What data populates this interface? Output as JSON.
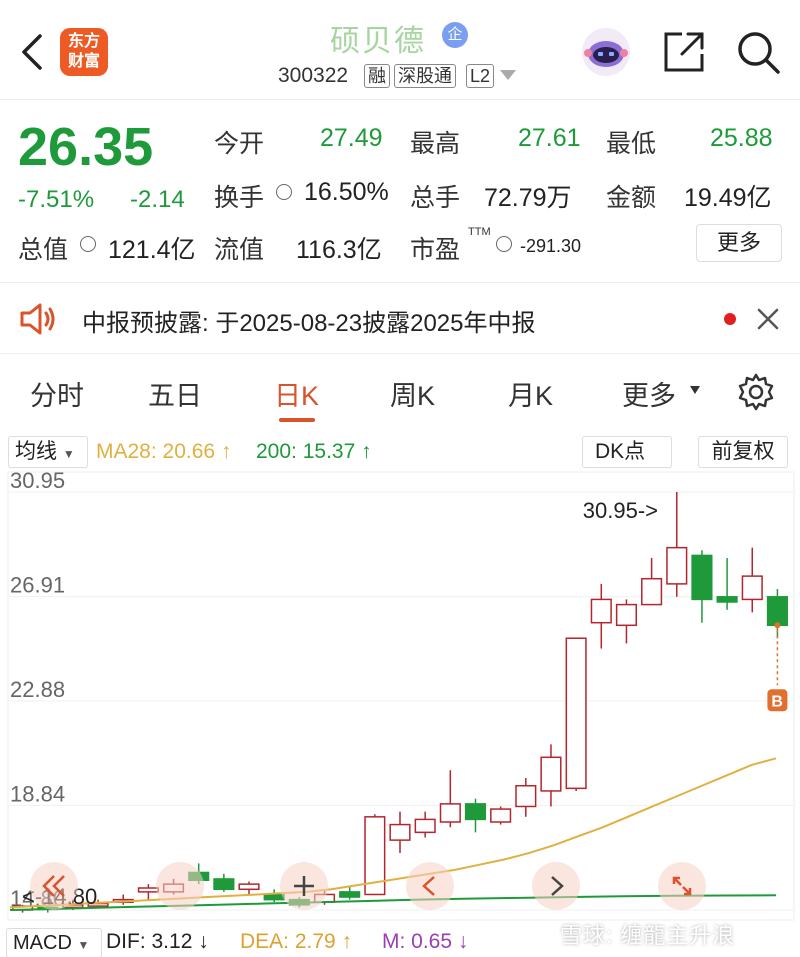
{
  "header": {
    "brand_line1": "东方",
    "brand_line2": "财富",
    "stock_name": "硕贝德",
    "enterprise_badge": "企",
    "code": "300322",
    "tags": [
      "融",
      "深股通",
      "L2"
    ]
  },
  "quote": {
    "price": "26.35",
    "change_pct": "-7.51%",
    "change_abs": "-2.14",
    "fields": {
      "open_label": "今开",
      "open": "27.49",
      "high_label": "最高",
      "high": "27.61",
      "low_label": "最低",
      "low": "25.88",
      "turnover_label": "换手",
      "turnover": "16.50%",
      "volume_label": "总手",
      "volume": "72.79万",
      "amount_label": "金额",
      "amount": "19.49亿",
      "mcap_label": "总值",
      "mcap": "121.4亿",
      "float_label": "流值",
      "float": "116.3亿",
      "pe_label": "市盈",
      "pe_sup": "TTM",
      "pe": "-291.30"
    },
    "more_button": "更多"
  },
  "notice": {
    "text": "中报预披露: 于2025-08-23披露2025年中报"
  },
  "tabs": [
    "分时",
    "五日",
    "日K",
    "周K",
    "月K",
    "更多"
  ],
  "active_tab": 2,
  "chart_toolbar": {
    "ma_select": "均线",
    "ma28": "MA28: 20.66",
    "ma200": "200: 15.37",
    "dk_button": "DK点",
    "adjust_button": "前复权"
  },
  "chart_data": {
    "type": "candlestick",
    "y_ticks": [
      "30.95",
      "26.91",
      "22.88",
      "18.84",
      "14.80"
    ],
    "ylim": [
      14.8,
      30.95
    ],
    "annotations": {
      "high_marker": "30.95->",
      "low_marker": "<-14.80",
      "buy_marker": "B"
    },
    "candles": [
      {
        "o": 14.8,
        "c": 14.95,
        "h": 15.0,
        "l": 14.7
      },
      {
        "o": 14.9,
        "c": 14.85,
        "h": 15.0,
        "l": 14.7
      },
      {
        "o": 14.9,
        "c": 15.0,
        "h": 15.2,
        "l": 14.8
      },
      {
        "o": 14.95,
        "c": 15.05,
        "h": 15.2,
        "l": 14.9
      },
      {
        "o": 15.1,
        "c": 15.2,
        "h": 15.4,
        "l": 15.0
      },
      {
        "o": 15.5,
        "c": 15.65,
        "h": 15.8,
        "l": 15.2
      },
      {
        "o": 15.5,
        "c": 15.8,
        "h": 16.0,
        "l": 15.4
      },
      {
        "o": 16.25,
        "c": 15.95,
        "h": 16.6,
        "l": 15.8
      },
      {
        "o": 16.0,
        "c": 15.6,
        "h": 16.2,
        "l": 15.5
      },
      {
        "o": 15.6,
        "c": 15.8,
        "h": 15.9,
        "l": 15.4
      },
      {
        "o": 15.4,
        "c": 15.2,
        "h": 15.6,
        "l": 15.1
      },
      {
        "o": 15.2,
        "c": 15.0,
        "h": 15.3,
        "l": 14.9
      },
      {
        "o": 15.1,
        "c": 15.4,
        "h": 15.6,
        "l": 15.0
      },
      {
        "o": 15.5,
        "c": 15.3,
        "h": 15.7,
        "l": 15.2
      },
      {
        "o": 15.4,
        "c": 18.4,
        "h": 18.5,
        "l": 15.4
      },
      {
        "o": 17.5,
        "c": 18.1,
        "h": 18.6,
        "l": 17.0
      },
      {
        "o": 17.8,
        "c": 18.3,
        "h": 18.6,
        "l": 17.6
      },
      {
        "o": 18.2,
        "c": 18.9,
        "h": 20.2,
        "l": 18.0
      },
      {
        "o": 18.9,
        "c": 18.3,
        "h": 19.1,
        "l": 17.8
      },
      {
        "o": 18.2,
        "c": 18.7,
        "h": 18.8,
        "l": 18.1
      },
      {
        "o": 18.8,
        "c": 19.6,
        "h": 19.9,
        "l": 18.4
      },
      {
        "o": 19.4,
        "c": 20.7,
        "h": 21.2,
        "l": 18.8
      },
      {
        "o": 19.5,
        "c": 25.3,
        "h": 25.3,
        "l": 19.4
      },
      {
        "o": 25.9,
        "c": 26.8,
        "h": 27.4,
        "l": 24.9
      },
      {
        "o": 25.8,
        "c": 26.6,
        "h": 26.8,
        "l": 25.1
      },
      {
        "o": 26.6,
        "c": 27.6,
        "h": 28.4,
        "l": 26.6
      },
      {
        "o": 27.4,
        "c": 28.8,
        "h": 30.95,
        "l": 26.9
      },
      {
        "o": 28.5,
        "c": 26.8,
        "h": 28.7,
        "l": 25.9
      },
      {
        "o": 26.9,
        "c": 26.7,
        "h": 28.4,
        "l": 26.4
      },
      {
        "o": 26.8,
        "c": 27.7,
        "h": 28.8,
        "l": 26.3
      },
      {
        "o": 26.9,
        "c": 25.8,
        "h": 27.2,
        "l": 25.3
      }
    ],
    "ma28_series": [
      14.9,
      14.95,
      15.0,
      15.05,
      15.1,
      15.15,
      15.2,
      15.25,
      15.3,
      15.35,
      15.4,
      15.45,
      15.5,
      15.6,
      15.75,
      15.9,
      16.05,
      16.2,
      16.35,
      16.55,
      16.75,
      17.0,
      17.3,
      17.65,
      18.0,
      18.4,
      18.8,
      19.2,
      19.6,
      20.0,
      20.4,
      20.66
    ],
    "ma200_series": [
      14.8,
      14.85,
      14.9,
      14.95,
      15.0,
      15.05,
      15.1,
      15.15,
      15.2,
      15.24,
      15.27,
      15.3,
      15.33,
      15.35,
      15.36,
      15.37
    ]
  },
  "macd": {
    "select": "MACD",
    "dif": "DIF: 3.12",
    "dea": "DEA: 2.79",
    "m": "M: 0.65"
  },
  "watermark": "雪球: 缠龍主升浪",
  "colors": {
    "up": "#b3262e",
    "down": "#1e9a3a",
    "accent": "#d9532c",
    "ma28": "#e0b040",
    "ma200": "#1e9a3a"
  }
}
